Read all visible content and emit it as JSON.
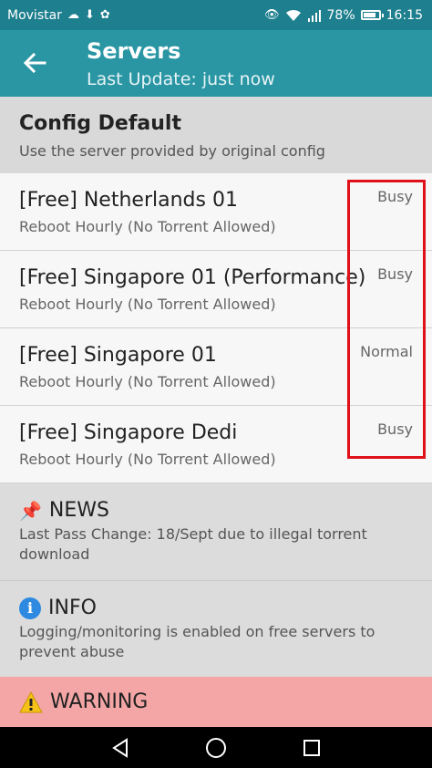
{
  "status_bar": {
    "carrier": "Movistar",
    "battery": "78%",
    "time": "16:15"
  },
  "app_bar": {
    "title": "Servers",
    "subtitle": "Last Update: just now"
  },
  "config_default": {
    "title": "Config Default",
    "description": "Use the server provided by original config"
  },
  "servers": [
    {
      "name": "[Free] Netherlands 01",
      "description": "Reboot Hourly (No Torrent Allowed)",
      "status": "Busy"
    },
    {
      "name": "[Free] Singapore 01 (Performance)",
      "description": "Reboot Hourly (No Torrent Allowed)",
      "status": "Busy"
    },
    {
      "name": "[Free] Singapore 01",
      "description": "Reboot Hourly (No Torrent Allowed)",
      "status": "Normal"
    },
    {
      "name": "[Free] Singapore Dedi",
      "description": "Reboot Hourly (No Torrent Allowed)",
      "status": "Busy"
    }
  ],
  "news": {
    "heading": "NEWS",
    "body": "Last Pass Change: 18/Sept due to illegal torrent download"
  },
  "info": {
    "heading": "INFO",
    "body": "Logging/monitoring is enabled on free servers to prevent abuse"
  },
  "warning": {
    "heading": "WARNING"
  },
  "colors": {
    "status_bar": "#1e7f8e",
    "app_bar": "#2a96a4",
    "highlight": "#e0101a",
    "warning_bg": "#f4a6a6"
  }
}
